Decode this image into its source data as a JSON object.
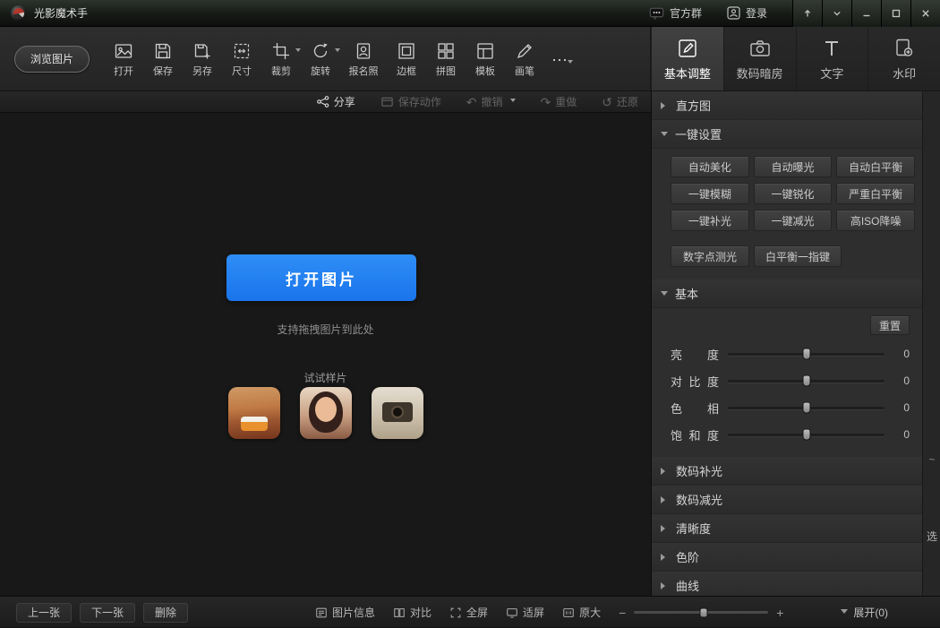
{
  "titlebar": {
    "app_name": "光影魔术手",
    "official_group": "官方群",
    "login": "登录"
  },
  "toolbar": {
    "browse_label": "浏览图片",
    "items": [
      {
        "label": "打开"
      },
      {
        "label": "保存"
      },
      {
        "label": "另存"
      },
      {
        "label": "尺寸"
      },
      {
        "label": "裁剪"
      },
      {
        "label": "旋转"
      },
      {
        "label": "报名照"
      },
      {
        "label": "边框"
      },
      {
        "label": "拼图"
      },
      {
        "label": "模板"
      },
      {
        "label": "画笔"
      }
    ]
  },
  "tabs": [
    {
      "label": "基本调整",
      "active": true
    },
    {
      "label": "数码暗房",
      "active": false
    },
    {
      "label": "文字",
      "active": false
    },
    {
      "label": "水印",
      "active": false
    }
  ],
  "subtoolbar": {
    "share": "分享",
    "save_action": "保存动作",
    "undo": "撤销",
    "redo": "重做",
    "restore": "还原"
  },
  "canvas": {
    "open_button": "打开图片",
    "drop_hint": "支持拖拽图片到此处",
    "samples_label": "试试样片"
  },
  "panel": {
    "histogram_title": "直方图",
    "onekey_title": "一键设置",
    "onekey_buttons": [
      "自动美化",
      "自动曝光",
      "自动白平衡",
      "一键模糊",
      "一键锐化",
      "严重白平衡",
      "一键补光",
      "一键减光",
      "高ISO降噪"
    ],
    "onekey_buttons_row4": [
      "数字点测光",
      "白平衡一指键"
    ],
    "basic_title": "基本",
    "reset": "重置",
    "sliders": [
      {
        "label": "亮度",
        "value": "0"
      },
      {
        "label": "对比度",
        "value": "0"
      },
      {
        "label": "色相",
        "value": "0"
      },
      {
        "label": "饱和度",
        "value": "0"
      }
    ],
    "collapsed": [
      "数码补光",
      "数码减光",
      "清晰度",
      "色阶",
      "曲线"
    ]
  },
  "statusbar": {
    "prev": "上一张",
    "next": "下一张",
    "delete": "删除",
    "image_info": "图片信息",
    "compare": "对比",
    "fullscreen": "全屏",
    "fit_screen": "适屏",
    "original_size": "原大",
    "zoom_out": "−",
    "zoom_in": "+",
    "expand": "展开(0)"
  },
  "side_strip": {
    "glyph": "选",
    "glyph_top": "~"
  },
  "icons": {
    "more": "⋯",
    "undo": "↶",
    "redo": "↷",
    "restore": "↺"
  },
  "colors": {
    "accent_blue": "#1f7ef0",
    "panel_bg": "#2e2e2e",
    "canvas_bg": "#181818"
  }
}
